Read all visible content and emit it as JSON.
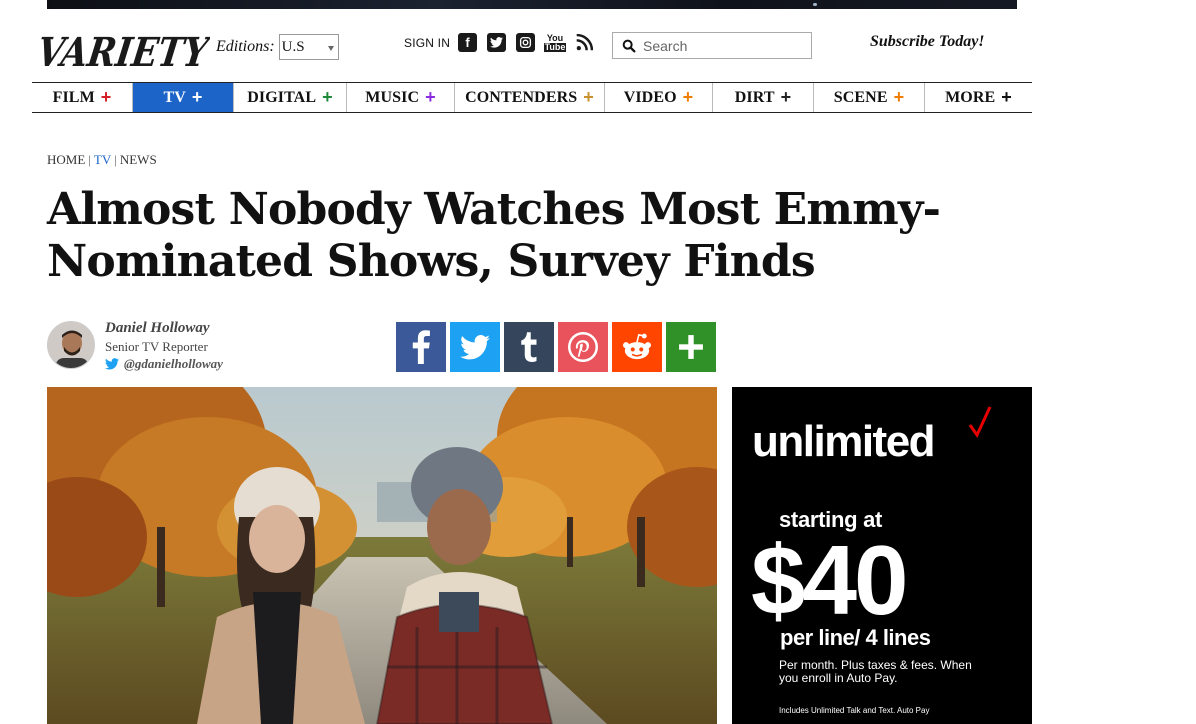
{
  "header": {
    "logo_text": "VARIETY",
    "editions_label": "Editions:",
    "edition_selected": "U.S",
    "signin": "SIGN IN",
    "social_icons": [
      "facebook-icon",
      "twitter-icon",
      "instagram-icon",
      "youtube-icon",
      "rss-icon"
    ],
    "youtube_text_top": "You",
    "youtube_text_bottom": "Tube",
    "search_placeholder": "Search",
    "subscribe": "Subscribe Today!"
  },
  "nav": {
    "items": [
      {
        "label": "FILM",
        "color": "#d5202a"
      },
      {
        "label": "TV",
        "color": "#ffffff"
      },
      {
        "label": "DIGITAL",
        "color": "#1d8a3a"
      },
      {
        "label": "MUSIC",
        "color": "#8a2be2"
      },
      {
        "label": "CONTENDERS",
        "color": "#c8912f"
      },
      {
        "label": "VIDEO",
        "color": "#ef7d00"
      },
      {
        "label": "DIRT",
        "color": "#222222"
      },
      {
        "label": "SCENE",
        "color": "#ef7d00"
      },
      {
        "label": "MORE",
        "color": "#111111"
      }
    ],
    "active": "TV",
    "active_bg": "#1c64c7"
  },
  "breadcrumb": {
    "home": "HOME",
    "tv": "TV",
    "news": "NEWS",
    "separator": "|"
  },
  "article": {
    "headline_line1": "Almost Nobody Watches Most Emmy-",
    "headline_line2": "Nominated Shows, Survey Finds",
    "author_name": "Daniel Holloway",
    "author_role": "Senior TV Reporter",
    "author_handle": "@gdanielholloway"
  },
  "share": [
    "facebook-icon",
    "twitter-icon",
    "tumblr-icon",
    "pinterest-icon",
    "reddit-icon",
    "plus-icon"
  ],
  "ad": {
    "brand_word": "unlimited",
    "starting": "starting at",
    "price": "$40",
    "per_line": "per line/ 4 lines",
    "fine_print": "Per month. Plus taxes & fees. When you enroll in Auto Pay.",
    "fine_print_small": "Includes Unlimited Talk and Text. Auto Pay"
  }
}
